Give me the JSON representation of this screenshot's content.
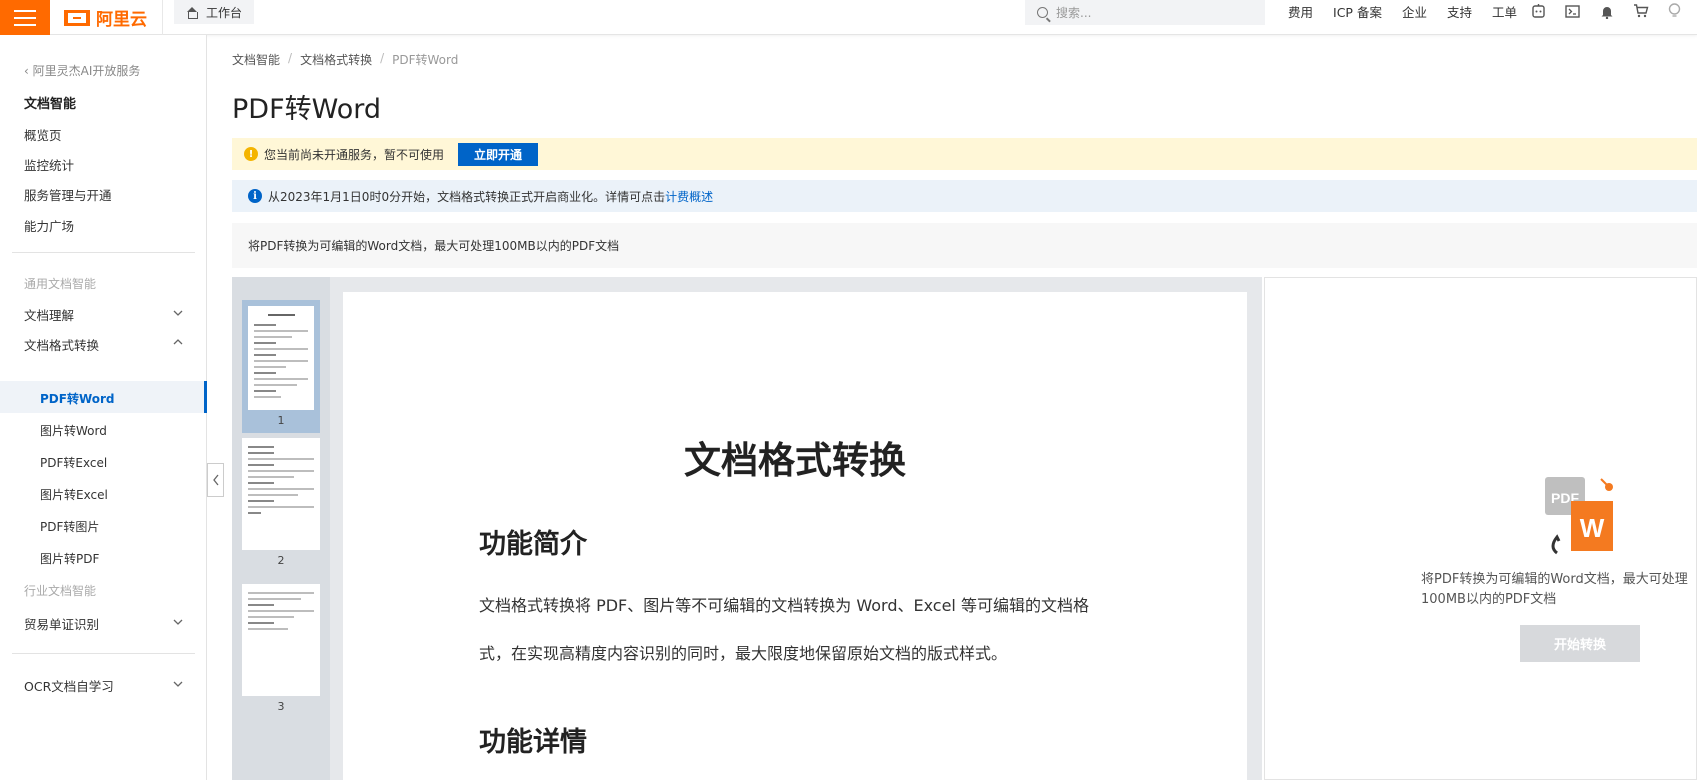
{
  "topbar": {
    "logo_text": "阿里云",
    "workbench_label": "工作台",
    "search_placeholder": "搜索...",
    "nav": [
      "费用",
      "ICP 备案",
      "企业",
      "支持",
      "工单"
    ],
    "icons": [
      "ai-assistant-icon",
      "terminal-icon",
      "bell-icon",
      "cart-icon",
      "lightbulb-icon"
    ]
  },
  "sidebar": {
    "back_label": "阿里灵杰AI开放服务",
    "title": "文档智能",
    "items": [
      "概览页",
      "监控统计",
      "服务管理与开通",
      "能力广场"
    ],
    "group_general": "通用文档智能",
    "doc_understanding": "文档理解",
    "doc_conversion": "文档格式转换",
    "sub_items": [
      "PDF转Word",
      "图片转Word",
      "PDF转Excel",
      "图片转Excel",
      "PDF转图片",
      "图片转PDF"
    ],
    "group_industry": "行业文档智能",
    "trade_docs": "贸易单证识别",
    "ocr_learning": "OCR文档自学习"
  },
  "main": {
    "breadcrumb": [
      "文档智能",
      "文档格式转换",
      "PDF转Word"
    ],
    "page_title": "PDF转Word",
    "warning_text": "您当前尚未开通服务，暂不可使用",
    "open_button": "立即开通",
    "info_text": "从2023年1月1日0时0分开始，文档格式转换正式开启商业化。详情可点击",
    "info_link": "计费概述",
    "description": "将PDF转换为可编辑的Word文档，最大可处理100MB以内的PDF文档"
  },
  "viewer": {
    "thumb_numbers": [
      "1",
      "2",
      "3"
    ],
    "doc_title": "文档格式转换",
    "heading_intro": "功能简介",
    "paragraph": "文档格式转换将 PDF、图片等不可编辑的文档转换为 Word、Excel 等可编辑的文档格式，在实现高精度内容识别的同时，最大限度地保留原始文档的版式样式。",
    "heading_details": "功能详情"
  },
  "panel": {
    "icon_pdf_label": "PDF",
    "icon_word_label": "W",
    "text": "将PDF转换为可编辑的Word文档，最大可处理100MB以内的PDF文档",
    "start_button": "开始转换"
  },
  "colors": {
    "brand_orange": "#ff6a00",
    "primary_blue": "#0064c8",
    "warning_bg": "#fff7d7",
    "info_bg": "#ebf2f9"
  }
}
